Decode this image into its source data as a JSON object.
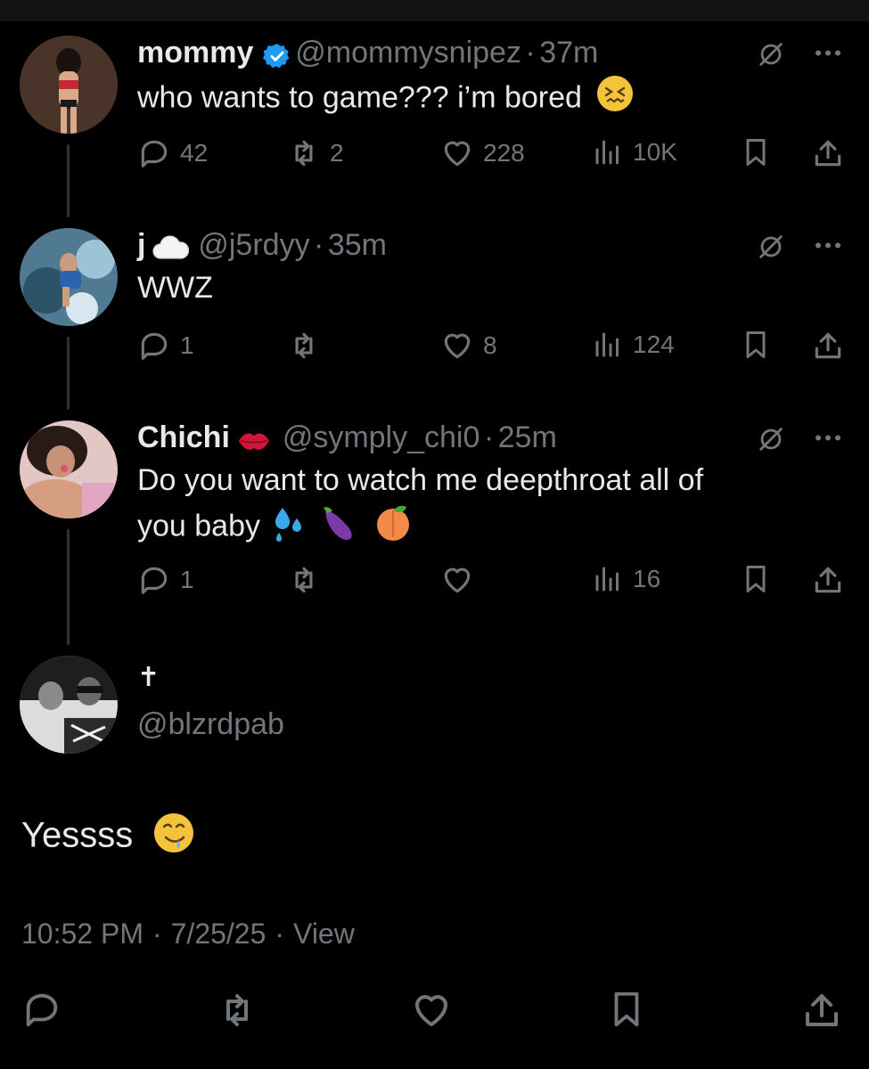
{
  "posts": [
    {
      "name": "mommy",
      "handle": "@mommysnipez",
      "time": "37m",
      "text": "who wants to game??? i’m bored",
      "replies": "42",
      "reposts": "2",
      "likes": "228",
      "views": "10K"
    },
    {
      "name": "j",
      "handle": "@j5rdyy",
      "time": "35m",
      "text": "WWZ",
      "replies": "1",
      "reposts": "",
      "likes": "8",
      "views": "124"
    },
    {
      "name": "Chichi",
      "handle": "@symply_chi0",
      "time": "25m",
      "text_line1": "Do you want to watch me deepthroat all of",
      "text_line2": "you baby",
      "replies": "1",
      "reposts": "",
      "likes": "",
      "views": "16"
    }
  ],
  "focused": {
    "name": "✝",
    "handle": "@blzrdpab",
    "text": "Yessss",
    "time": "10:52 PM",
    "date": "7/25/25",
    "view_label": "View"
  },
  "separators": {
    "dot": "·"
  },
  "icons": {
    "reply": "reply-icon",
    "repost": "repost-icon",
    "like": "heart-icon",
    "views": "views-icon",
    "bookmark": "bookmark-icon",
    "share": "share-icon",
    "grok": "grok-icon",
    "more": "more-icon"
  },
  "colors": {
    "background": "#000000",
    "text": "#e7e9ea",
    "muted": "#71767b",
    "verified": "#1d9bf0"
  }
}
